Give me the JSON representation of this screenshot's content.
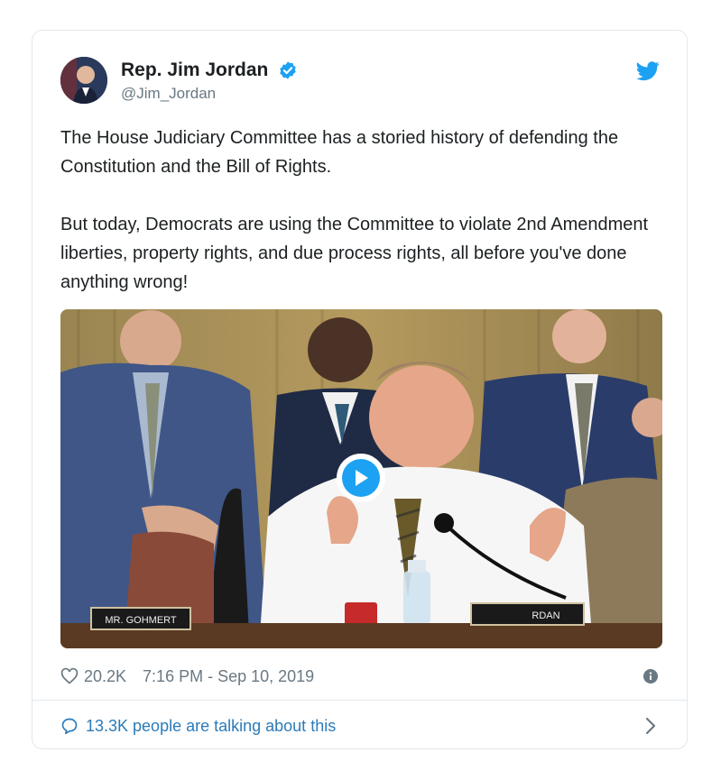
{
  "tweet": {
    "author": {
      "display_name": "Rep. Jim Jordan",
      "handle": "@Jim_Jordan",
      "verified_icon": "verified-badge-icon"
    },
    "brand_icon": "twitter-bird-icon",
    "text": "The House Judiciary Committee has a storied history of defending the Constitution and the Bill of Rights.\n\nBut today, Democrats are using the Committee to violate 2nd Amendment liberties, property rights, and due process rights, all before you've done anything wrong!",
    "media": {
      "type": "video",
      "play_icon": "play-icon",
      "nameplates": [
        "MR. GOHMERT",
        "RDAN"
      ]
    },
    "likes": "20.2K",
    "timestamp": "7:16 PM - Sep 10, 2019",
    "conversation": "13.3K people are talking about this"
  },
  "colors": {
    "accent": "#1da1f2",
    "link": "#2b7bb9",
    "meta_gray": "#697882",
    "border": "#e1e8ed"
  }
}
